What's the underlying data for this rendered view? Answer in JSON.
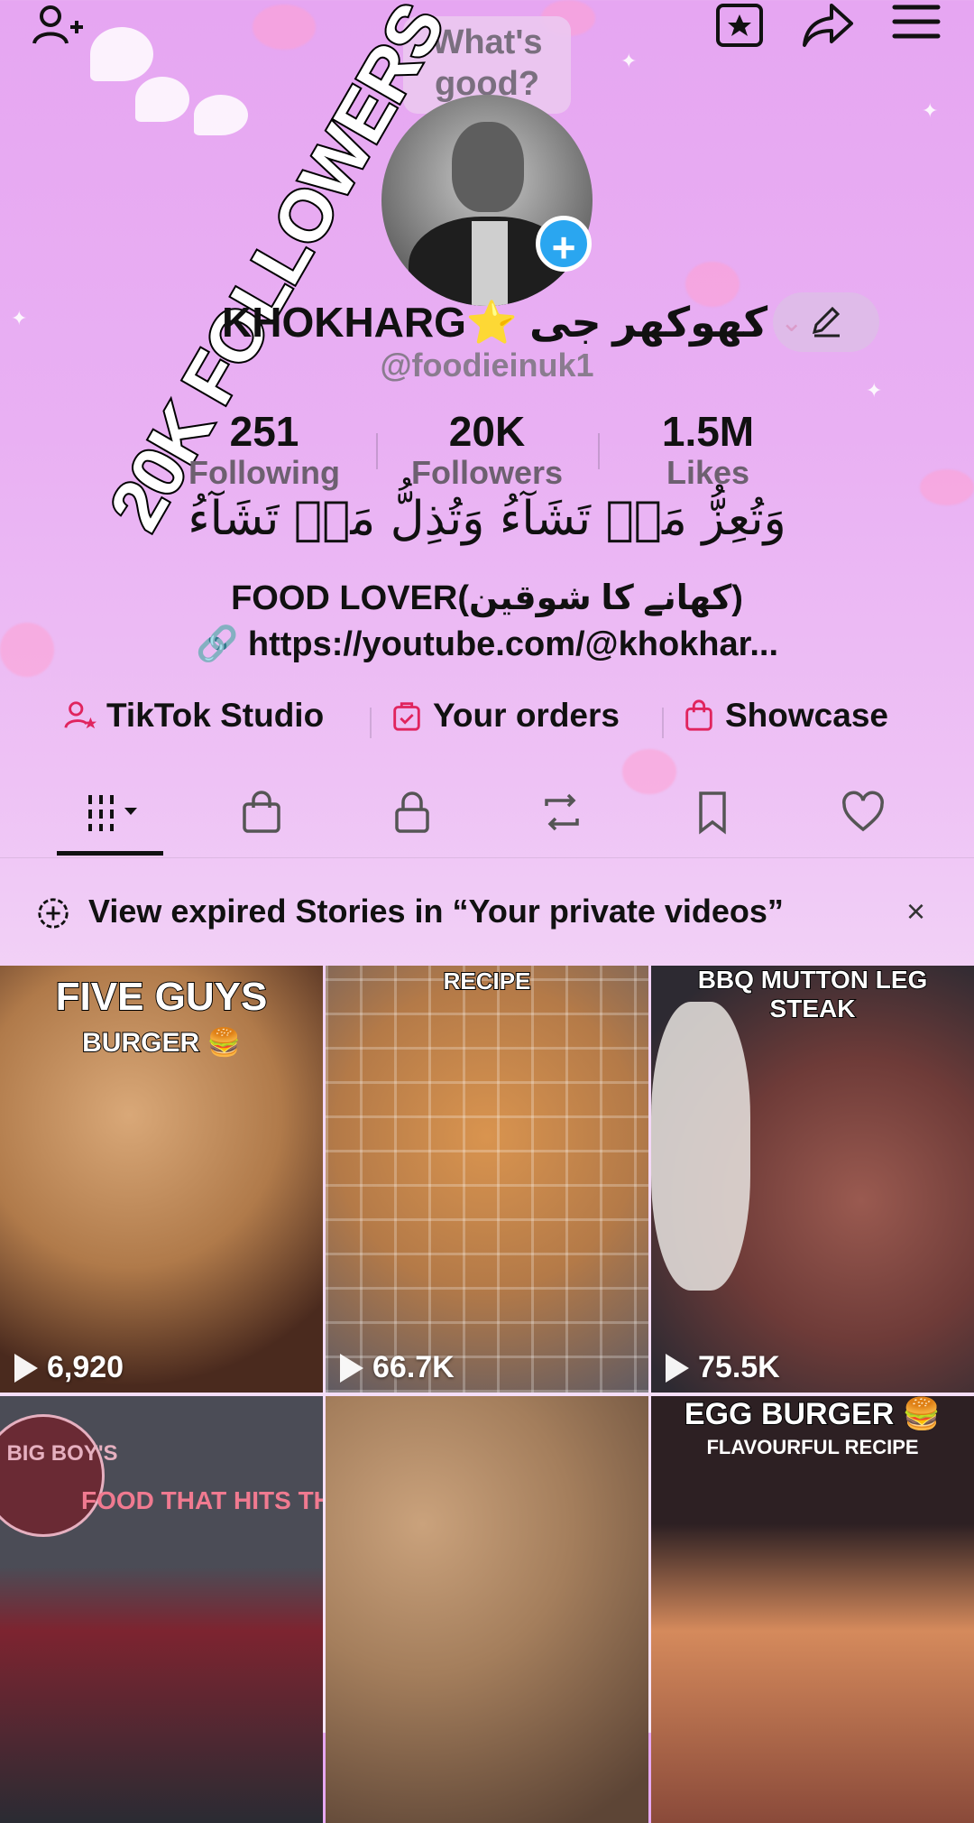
{
  "top_bar": {
    "icons": [
      "add-friend-icon",
      "calendar-star-icon",
      "share-icon",
      "menu-icon"
    ]
  },
  "tooltip": {
    "text": "What's good?"
  },
  "overlay": {
    "text": "20K FOLLOWERS"
  },
  "profile": {
    "display_name": "KHOKHARG⭐ کھوکھر جی",
    "handle": "@foodieinuk1",
    "edit_icon": "pencil-icon"
  },
  "stats": [
    {
      "value": "251",
      "label": "Following"
    },
    {
      "value": "20K",
      "label": "Followers"
    },
    {
      "value": "1.5M",
      "label": "Likes"
    }
  ],
  "bio": {
    "arabic": "وَتُعِزُّ مَنۡ تَشَآءُ وَتُذِلُّ مَنۡ تَشَآءُ",
    "line": "FOOD LOVER(کھانے کا شوقین)",
    "link": "https://youtube.com/@khokhar..."
  },
  "quick_links": [
    {
      "label": "TikTok Studio",
      "icon": "person-star-icon"
    },
    {
      "label": "Your orders",
      "icon": "bag-check-icon"
    },
    {
      "label": "Showcase",
      "icon": "shopping-bag-icon"
    }
  ],
  "tabs": [
    "grid-filter-icon",
    "shop-bag-icon",
    "lock-icon",
    "repost-icon",
    "bookmark-icon",
    "heart-icon"
  ],
  "banner": {
    "text": "View expired Stories in “Your private videos”",
    "icon": "story-plus-icon",
    "close": "×"
  },
  "videos": [
    {
      "caption": "FIVE GUYS",
      "subcaption": "BURGER 🍔",
      "views": "6,920",
      "colors": [
        "#c79a6a",
        "#6b3a22"
      ]
    },
    {
      "caption": "RECIPE",
      "subcaption": "",
      "views": "66.7K",
      "colors": [
        "#c98a4f",
        "#7a5d4d"
      ]
    },
    {
      "caption": "BBQ MUTTON LEG STEAK",
      "subcaption": "",
      "views": "75.5K",
      "colors": [
        "#8a4a45",
        "#2f2a30"
      ]
    },
    {
      "caption": "FOOD THAT HITS TH",
      "subcaption": "BIG BOY'S",
      "views": "",
      "colors": [
        "#3a3b44",
        "#8a2a3a"
      ]
    },
    {
      "caption": "",
      "subcaption": "",
      "views": "",
      "colors": [
        "#b89472",
        "#6f5545"
      ]
    },
    {
      "caption": "EGG BURGER 🍔",
      "subcaption": "FLAVOURFUL RECIPE",
      "views": "",
      "colors": [
        "#d78a5a",
        "#3a2222"
      ]
    }
  ]
}
